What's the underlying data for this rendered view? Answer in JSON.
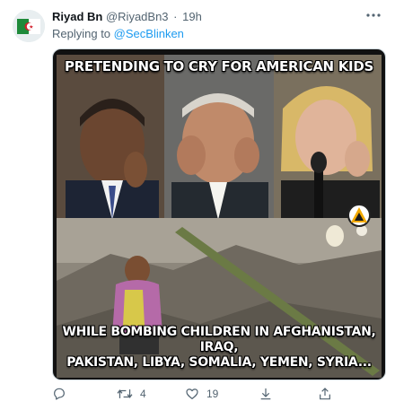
{
  "tweet": {
    "display_name": "Riyad Bn",
    "handle": "@RiyadBn3",
    "separator": "·",
    "time": "19h",
    "replying_prefix": "Replying to",
    "replying_to": "@SecBlinken",
    "more_icon": "more-horizontal-icon"
  },
  "media": {
    "top_caption": "PRETENDING TO CRY FOR AMERICAN KIDS",
    "bottom_caption_line1": "WHILE BOMBING CHILDREN IN AFGHANISTAN, IRAQ,",
    "bottom_caption_line2": "PAKISTAN, LIBYA, SOMALIA, YEMEN, SYRIA..."
  },
  "actions": {
    "reply_icon": "reply-icon",
    "retweet_icon": "retweet-icon",
    "retweet_count": "4",
    "like_icon": "heart-icon",
    "like_count": "19",
    "download_icon": "download-icon",
    "share_icon": "share-icon"
  },
  "colors": {
    "link": "#1d9bf0",
    "secondary_text": "#536471",
    "border": "#cfd9de"
  }
}
